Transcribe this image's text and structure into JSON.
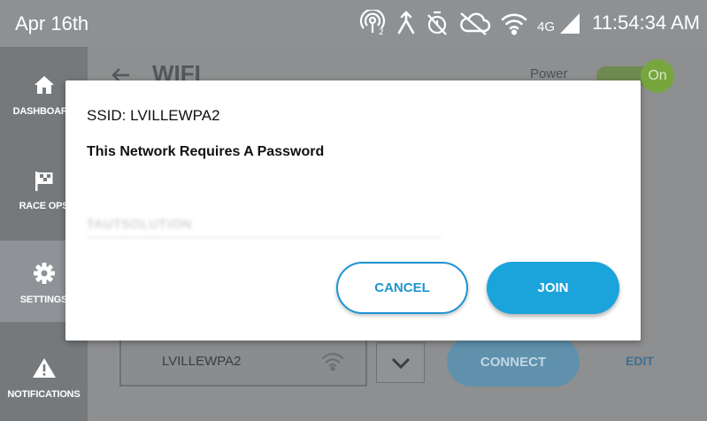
{
  "status_bar": {
    "date": "Apr 16th",
    "network": "4G",
    "time": "11:54:34 AM",
    "icons": [
      "hotspot-icon",
      "merge-arrow-icon",
      "timer-off-icon",
      "cloud-off-icon",
      "wifi-icon",
      "signal-icon"
    ]
  },
  "sidebar": {
    "items": [
      {
        "label": "DASHBOARD",
        "icon": "home-icon",
        "active": false
      },
      {
        "label": "RACE OPS",
        "icon": "race-flag-icon",
        "active": false
      },
      {
        "label": "SETTINGS",
        "icon": "gear-icon",
        "active": true
      },
      {
        "label": "NOTIFICATIONS",
        "icon": "warning-icon",
        "active": false
      }
    ]
  },
  "main": {
    "title": "WIFI",
    "power_label": "Power",
    "power_state": "On",
    "network_row": {
      "name": "LVILLEWPA2",
      "connect_label": "CONNECT",
      "edit_label": "EDIT"
    }
  },
  "dialog": {
    "ssid": "SSID: LVILLEWPA2",
    "message": "This Network Requires A Password",
    "password_value": "TAUTSOLUTION",
    "cancel_label": "CANCEL",
    "join_label": "JOIN"
  },
  "colors": {
    "accent": "#1ba3dc",
    "toggle_on": "#77a63f",
    "status_bar": "#8e9194",
    "sidebar": "#76797c"
  }
}
